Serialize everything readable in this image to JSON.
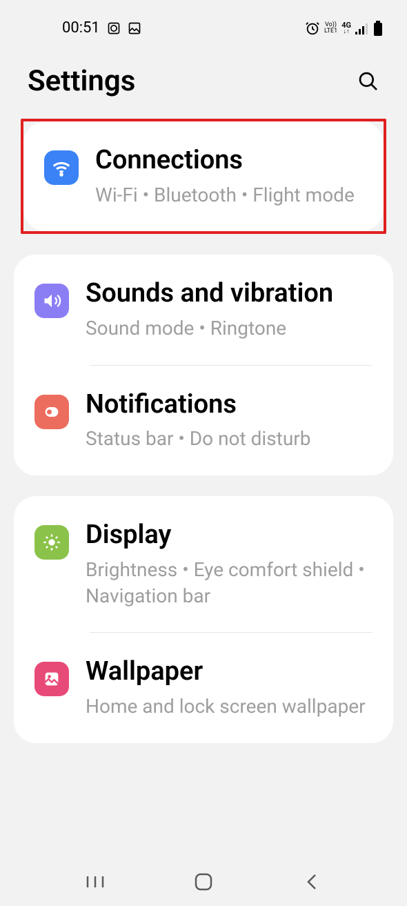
{
  "status": {
    "time": "00:51",
    "vo": "Vo))",
    "lte": "LTE1",
    "network": "4G"
  },
  "header": {
    "title": "Settings"
  },
  "groups": [
    {
      "highlighted": true,
      "items": [
        {
          "id": "connections",
          "icon": "wifi",
          "iconClass": "icon-blue",
          "title": "Connections",
          "subtitle": "Wi-Fi  •  Bluetooth  •  Flight mode"
        }
      ]
    },
    {
      "highlighted": false,
      "items": [
        {
          "id": "sounds",
          "icon": "speaker",
          "iconClass": "icon-purple",
          "title": "Sounds and vibration",
          "subtitle": "Sound mode  •  Ringtone"
        },
        {
          "id": "notifications",
          "icon": "bell",
          "iconClass": "icon-salmon",
          "title": "Notifications",
          "subtitle": "Status bar  •  Do not disturb"
        }
      ]
    },
    {
      "highlighted": false,
      "items": [
        {
          "id": "display",
          "icon": "sun",
          "iconClass": "icon-green",
          "title": "Display",
          "subtitle": "Brightness  •  Eye comfort shield  •  Navigation bar"
        },
        {
          "id": "wallpaper",
          "icon": "image",
          "iconClass": "icon-pink",
          "title": "Wallpaper",
          "subtitle": "Home and lock screen wallpaper"
        }
      ]
    }
  ]
}
